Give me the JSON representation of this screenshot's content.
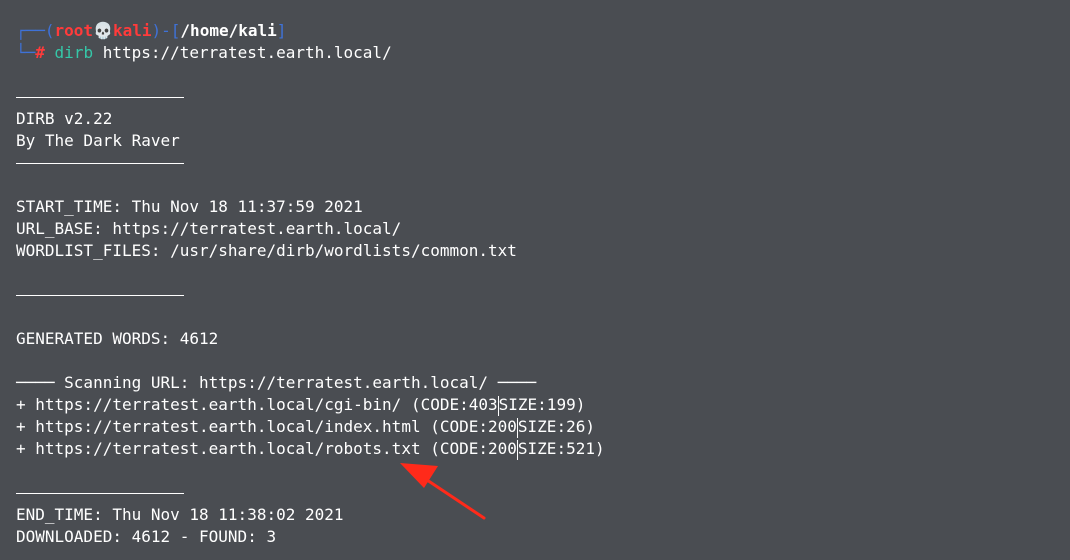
{
  "prompt": {
    "box_top": "┌──(",
    "user": "root",
    "skull": "💀",
    "host": "kali",
    "mid": ")-[",
    "path": "/home/kali",
    "close": "]",
    "box_bottom": "└─",
    "hash": "#",
    "command": "dirb",
    "argument": " https://terratest.earth.local/"
  },
  "header": {
    "version": "DIRB v2.22",
    "author": "By The Dark Raver"
  },
  "info": {
    "start_time": "START_TIME: Thu Nov 18 11:37:59 2021",
    "url_base": "URL_BASE: https://terratest.earth.local/",
    "wordlist": "WORDLIST_FILES: /usr/share/dirb/wordlists/common.txt"
  },
  "generated": "GENERATED WORDS: 4612",
  "scanning": "──── Scanning URL: https://terratest.earth.local/ ────",
  "results": [
    {
      "url": "+ https://terratest.earth.local/cgi-bin/ (CODE:403",
      "size": "SIZE:199)"
    },
    {
      "url": "+ https://terratest.earth.local/index.html (CODE:200",
      "size": "SIZE:26)"
    },
    {
      "url": "+ https://terratest.earth.local/robots.txt (CODE:200",
      "size": "SIZE:521)"
    }
  ],
  "footer": {
    "end_time": "END_TIME: Thu Nov 18 11:38:02 2021",
    "downloaded": "DOWNLOADED: 4612 - FOUND: 3"
  },
  "colors": {
    "background": "#4a4d52",
    "prompt_box": "#3f72d8",
    "prompt_user": "#ff3b3b",
    "command": "#35c7a8",
    "arrow": "#ff2a1a"
  },
  "annotation_icon": "red-arrow-icon"
}
